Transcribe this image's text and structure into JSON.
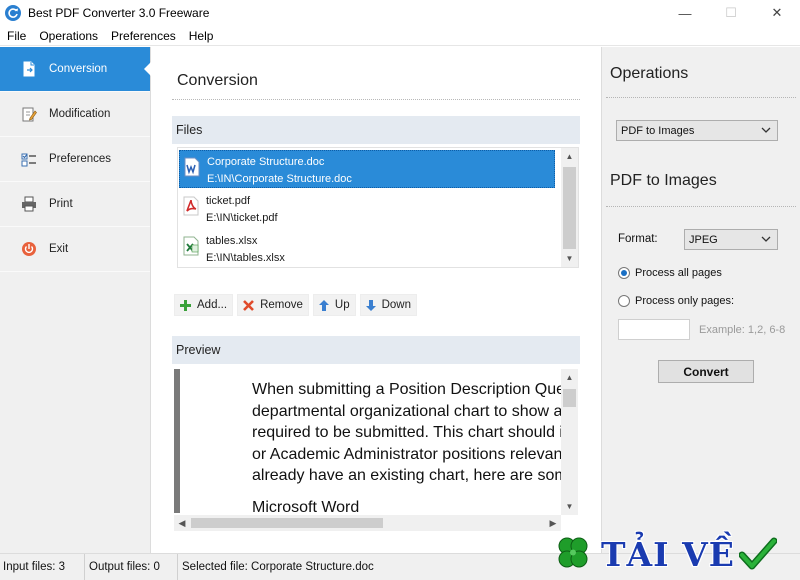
{
  "window": {
    "title": "Best PDF Converter 3.0 Freeware",
    "minimize": "—",
    "maximize": "☐",
    "close": "✕"
  },
  "menu": [
    "File",
    "Operations",
    "Preferences",
    "Help"
  ],
  "sidebar": {
    "items": [
      {
        "label": "Conversion",
        "icon": "conversion-icon",
        "active": true
      },
      {
        "label": "Modification",
        "icon": "modification-icon",
        "active": false
      },
      {
        "label": "Preferences",
        "icon": "preferences-icon",
        "active": false
      },
      {
        "label": "Print",
        "icon": "print-icon",
        "active": false
      },
      {
        "label": "Exit",
        "icon": "exit-icon",
        "active": false
      }
    ]
  },
  "main": {
    "title": "Conversion",
    "files_header": "Files",
    "files": [
      {
        "name": "Corporate Structure.doc",
        "path": "E:\\IN\\Corporate Structure.doc",
        "icon": "word-file-icon",
        "selected": true
      },
      {
        "name": "ticket.pdf",
        "path": "E:\\IN\\ticket.pdf",
        "icon": "pdf-file-icon",
        "selected": false
      },
      {
        "name": "tables.xlsx",
        "path": "E:\\IN\\tables.xlsx",
        "icon": "excel-file-icon",
        "selected": false
      }
    ],
    "toolbar": {
      "add": "Add...",
      "remove": "Remove",
      "up": "Up",
      "down": "Down"
    },
    "preview_header": "Preview",
    "preview_lines": [
      "When submitting a Position Description Ques",
      "departmental organizational chart to show all",
      "required to be submitted. This chart should in",
      "or Academic Administrator positions relevant",
      "already have an existing chart, here are some"
    ],
    "preview_heading": "Microsoft Word"
  },
  "operations": {
    "title": "Operations",
    "selected_operation": "PDF to Images",
    "sub_title": "PDF to Images",
    "format_label": "Format:",
    "format_value": "JPEG",
    "radio_all": "Process all pages",
    "radio_only": "Process only pages:",
    "pages_value": "",
    "pages_hint": "Example: 1,2, 6-8",
    "convert": "Convert"
  },
  "status": {
    "input_files": "Input files: 3",
    "output_files": "Output files: 0",
    "selected_file": "Selected file: Corporate Structure.doc"
  },
  "watermark": {
    "text": "TẢI VỀ"
  },
  "colors": {
    "accent": "#2a8bd8",
    "panel": "#f0f0f0",
    "group_header": "#e4eaf1",
    "watermark_text": "#1a3bb0",
    "watermark_clover": "#1f9d2a"
  }
}
